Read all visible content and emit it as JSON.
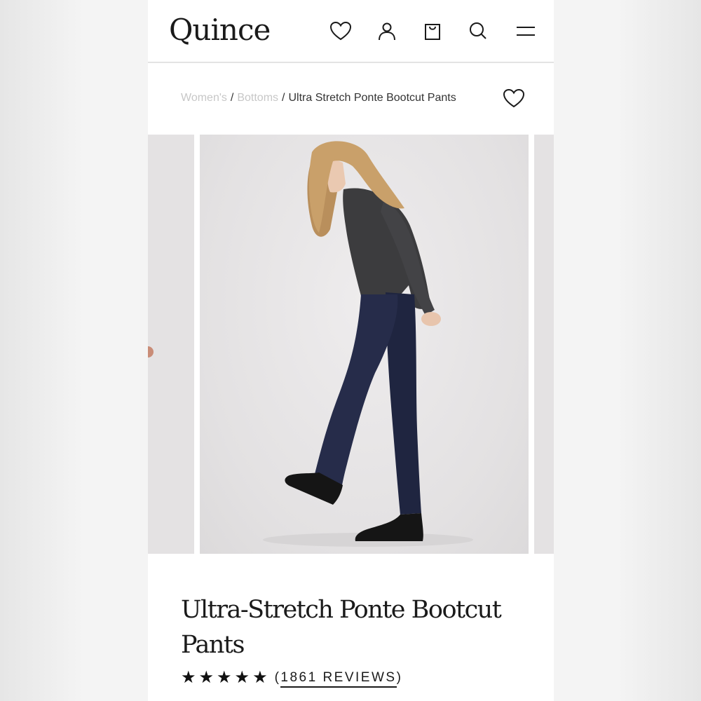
{
  "header": {
    "logo": "Quince",
    "icons": [
      "heart-icon",
      "account-icon",
      "bag-icon",
      "search-icon",
      "menu-icon"
    ]
  },
  "breadcrumb": {
    "items": [
      "Women's",
      "Bottoms",
      "Ultra Stretch Ponte Bootcut Pants"
    ],
    "separator": "/"
  },
  "product": {
    "title_line1": "Ultra-Stretch Ponte Bootcut",
    "title_line2": "Pants",
    "rating_stars": 5,
    "reviews_open": "(",
    "reviews_label": "1861 REVIEWS",
    "reviews_close": ")"
  },
  "colors": {
    "sweater": "#3c3c3e",
    "pants": "#1f2540",
    "boots": "#151515",
    "hair": "#c9a06a",
    "background": "#e4e2e3"
  }
}
